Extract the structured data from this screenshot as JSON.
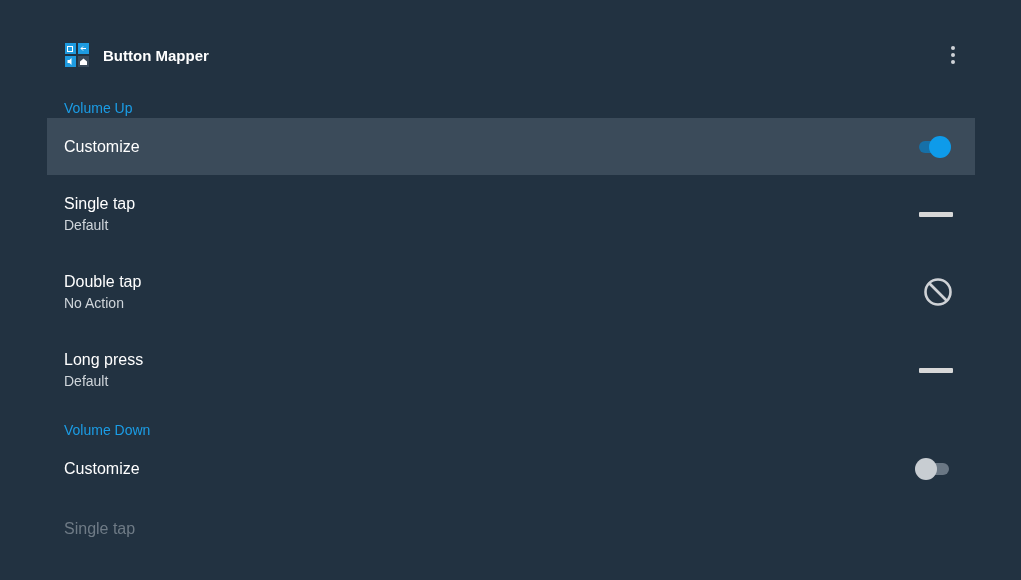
{
  "app_bar": {
    "title": "Button Mapper"
  },
  "sections": [
    {
      "title": "Volume Up",
      "rows": [
        {
          "kind": "toggle",
          "title": "Customize",
          "on": true,
          "focused": true
        },
        {
          "kind": "dash",
          "title": "Single tap",
          "subtitle": "Default",
          "focused": false
        },
        {
          "kind": "blocked",
          "title": "Double tap",
          "subtitle": "No Action",
          "focused": false
        },
        {
          "kind": "dash",
          "title": "Long press",
          "subtitle": "Default",
          "focused": false
        }
      ]
    },
    {
      "title": "Volume Down",
      "rows": [
        {
          "kind": "toggle",
          "title": "Customize",
          "on": false,
          "focused": false
        }
      ]
    }
  ],
  "cut_off_row": {
    "title": "Single tap"
  }
}
